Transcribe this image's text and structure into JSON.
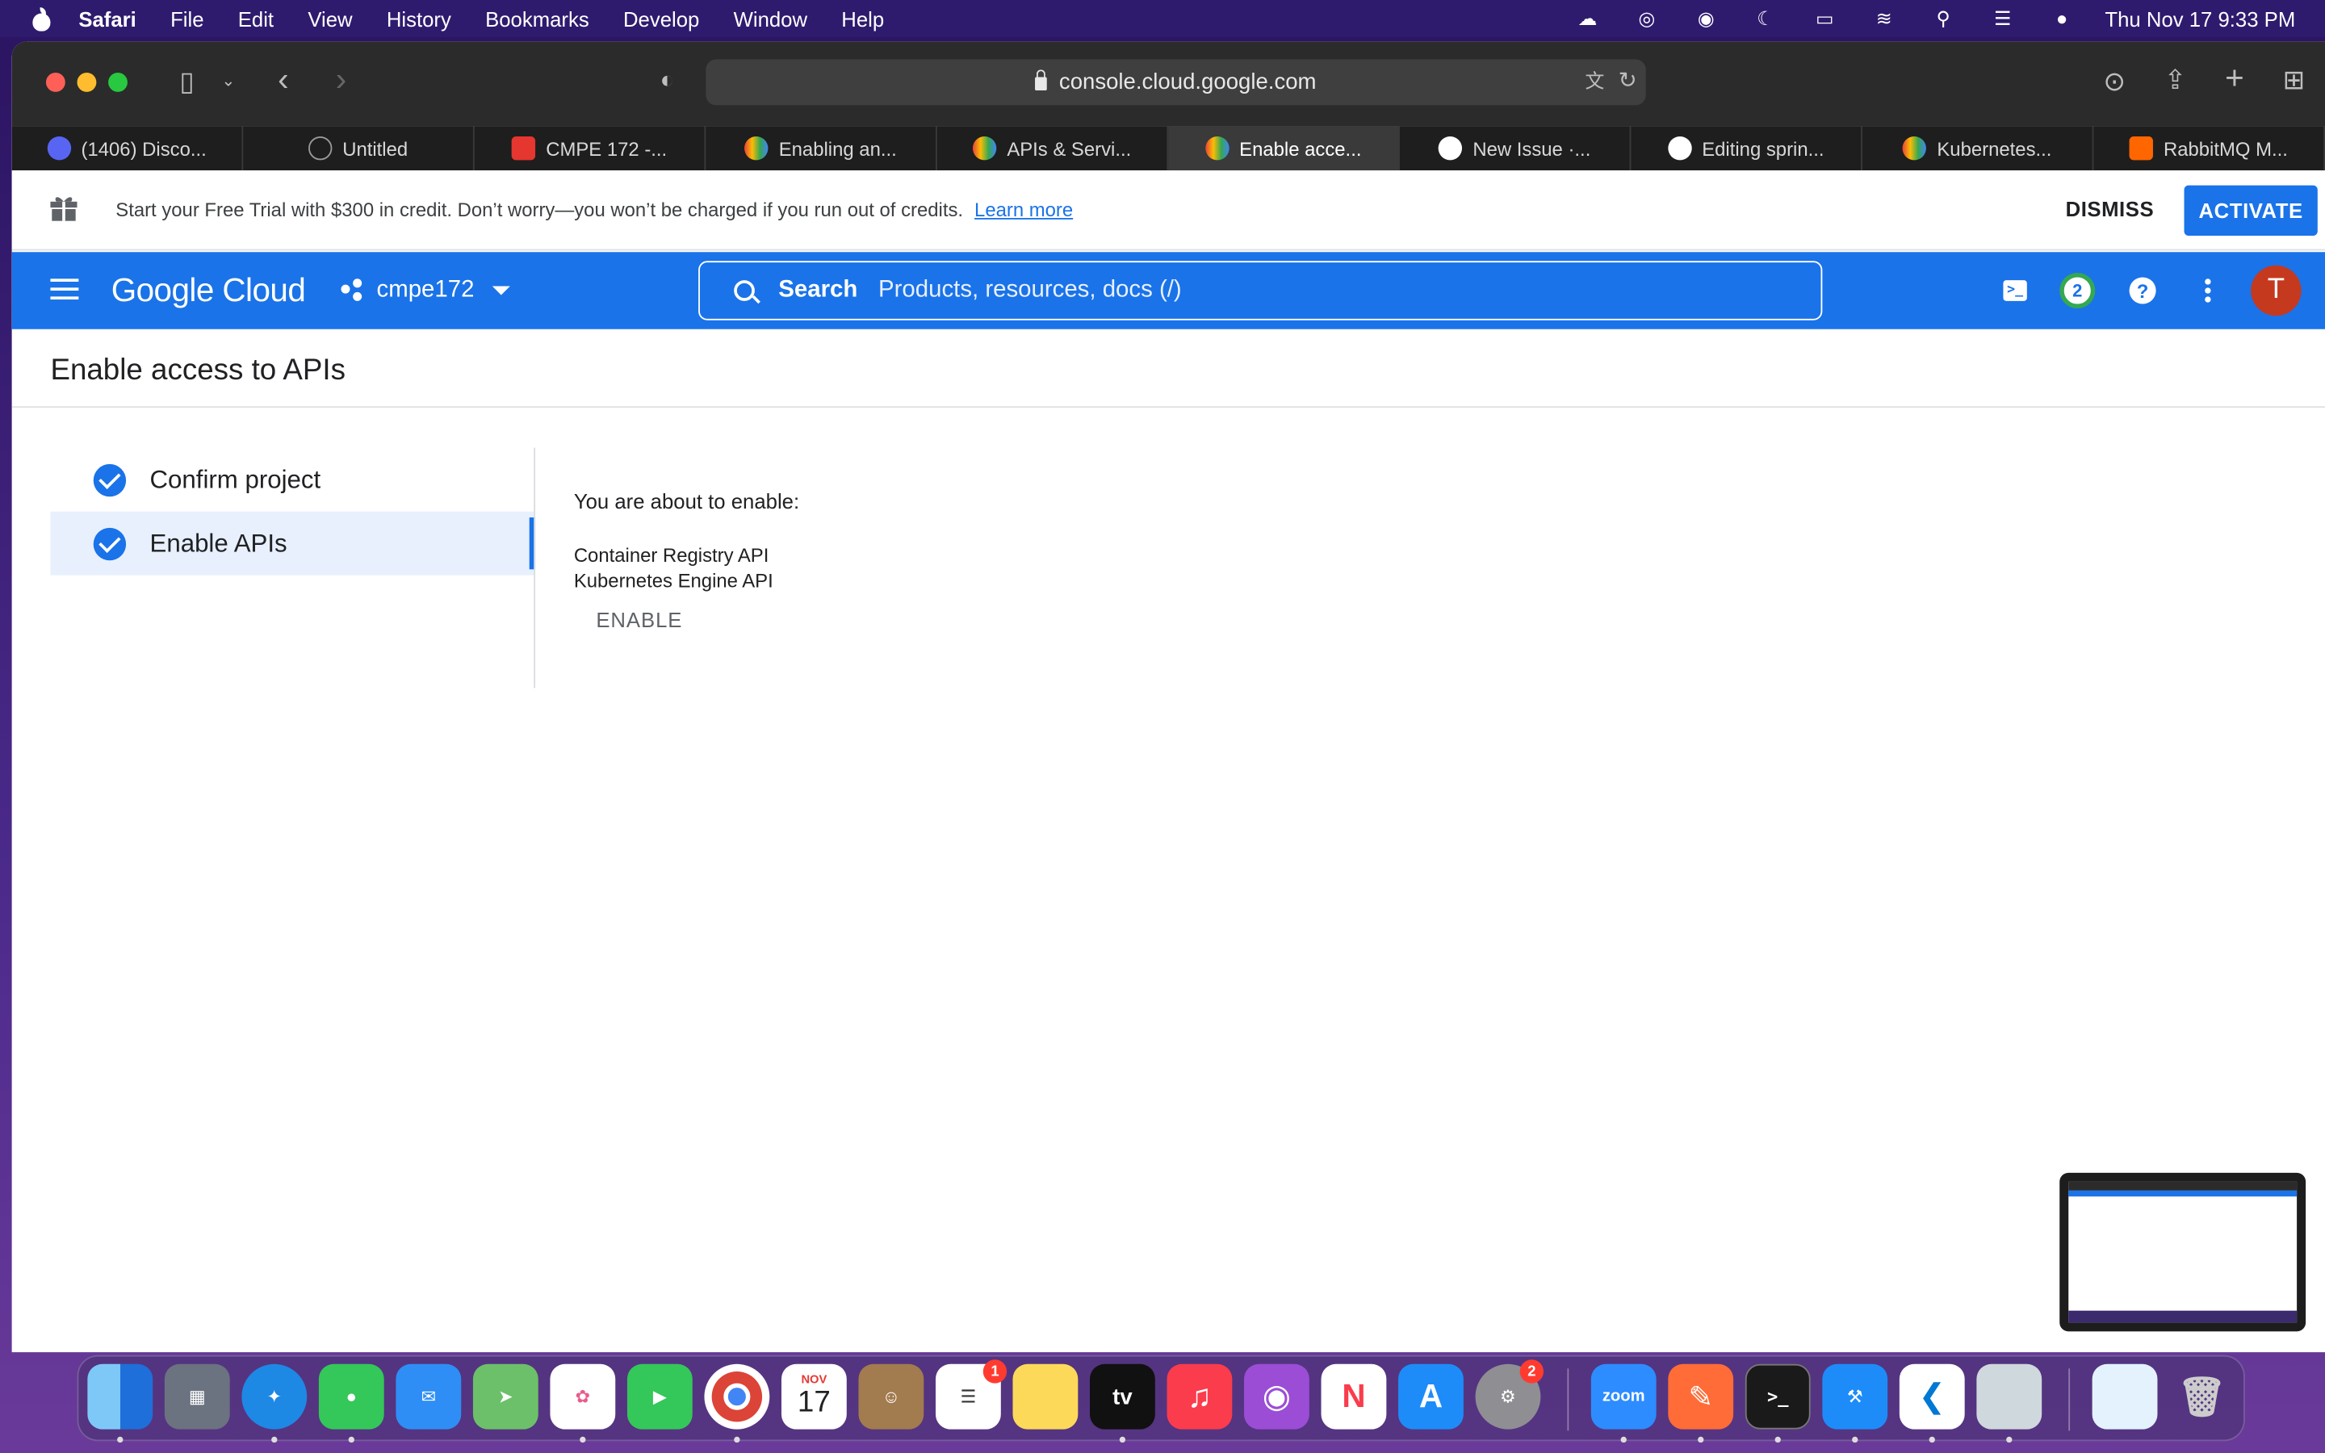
{
  "menubar": {
    "app_name": "Safari",
    "items": [
      "File",
      "Edit",
      "View",
      "History",
      "Bookmarks",
      "Develop",
      "Window",
      "Help"
    ],
    "clock": "Thu Nov 17  9:33 PM"
  },
  "browser": {
    "url": "console.cloud.google.com",
    "tabs": [
      {
        "label": "(1406) Disco...",
        "favicon_color": "#5865f2",
        "active": false
      },
      {
        "label": "Untitled",
        "favicon_color": "#8e8e8e",
        "active": false
      },
      {
        "label": "CMPE 172 -...",
        "favicon_color": "#e5362f",
        "active": false
      },
      {
        "label": "Enabling an...",
        "favicon_color": "#4285f4",
        "active": false
      },
      {
        "label": "APIs & Servi...",
        "favicon_color": "#4285f4",
        "active": false
      },
      {
        "label": "Enable acce...",
        "favicon_color": "#4285f4",
        "active": true
      },
      {
        "label": "New Issue ·...",
        "favicon_color": "#ffffff",
        "active": false
      },
      {
        "label": "Editing sprin...",
        "favicon_color": "#ffffff",
        "active": false
      },
      {
        "label": "Kubernetes...",
        "favicon_color": "#4285f4",
        "active": false
      },
      {
        "label": "RabbitMQ M...",
        "favicon_color": "#ff6600",
        "active": false
      }
    ]
  },
  "trial_banner": {
    "text": "Start your Free Trial with $300 in credit. Don’t worry—you won’t be charged if you run out of credits.",
    "learn_more": "Learn more",
    "dismiss": "DISMISS",
    "activate": "ACTIVATE"
  },
  "header": {
    "logo": "Google Cloud",
    "project": "cmpe172",
    "search_label": "Search",
    "search_placeholder": "Products, resources, docs (/)",
    "notification_count": "2",
    "avatar_initial": "T"
  },
  "page": {
    "title": "Enable access to APIs",
    "steps": [
      {
        "label": "Confirm project",
        "done": true,
        "selected": false
      },
      {
        "label": "Enable APIs",
        "done": true,
        "selected": true
      }
    ],
    "about_text": "You are about to enable:",
    "apis": [
      "Container Registry API",
      "Kubernetes Engine API"
    ],
    "enable_button": "ENABLE"
  },
  "dock": {
    "calendar_month": "NOV",
    "calendar_day": "17",
    "reminders_badge": "1",
    "settings_badge": "2",
    "zoom_label": "zoom",
    "tv_label": "tv"
  },
  "colors": {
    "accent": "#1a73e8",
    "menubar": "#2e1b6e"
  }
}
